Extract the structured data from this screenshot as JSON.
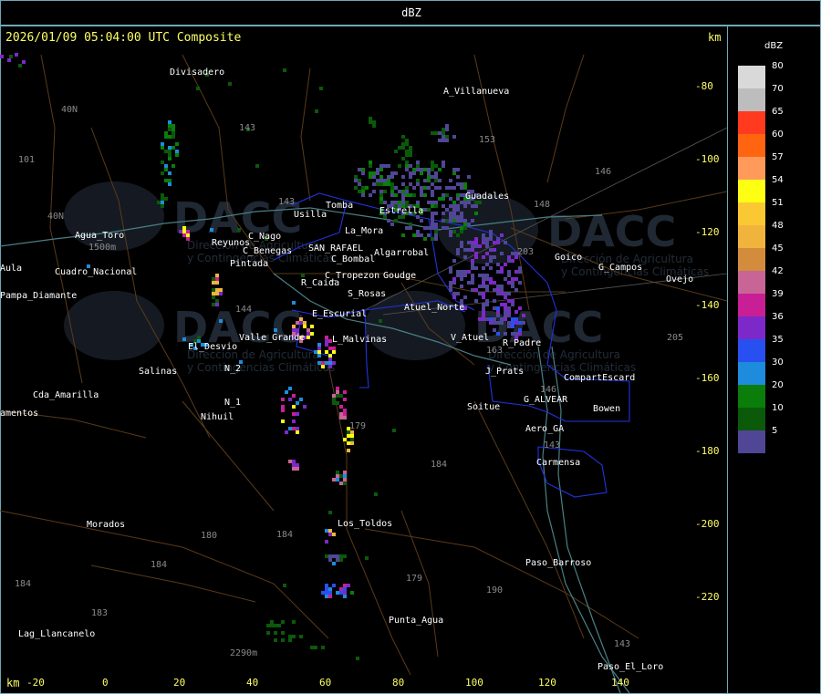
{
  "header": {
    "title": "dBZ"
  },
  "plot": {
    "timestamp": "2026/01/09 05:04:00 UTC Composite",
    "km_unit_top": "km",
    "km_unit_bottom": "km",
    "y_ticks": [
      "-80",
      "-100",
      "-120",
      "-140",
      "-160",
      "-180",
      "-200",
      "-220"
    ],
    "x_ticks": [
      "-20",
      "0",
      "20",
      "40",
      "60",
      "80",
      "100",
      "120",
      "140"
    ]
  },
  "legend": {
    "title": "dBZ",
    "levels": [
      {
        "label": "80",
        "color": "#d9d9d9"
      },
      {
        "label": "70",
        "color": "#bdbdbd"
      },
      {
        "label": "65",
        "color": "#ff3a1e"
      },
      {
        "label": "60",
        "color": "#ff6410"
      },
      {
        "label": "57",
        "color": "#ff9a5a"
      },
      {
        "label": "54",
        "color": "#ffff14"
      },
      {
        "label": "51",
        "color": "#fac832"
      },
      {
        "label": "48",
        "color": "#f0b43c"
      },
      {
        "label": "45",
        "color": "#d28c3c"
      },
      {
        "label": "42",
        "color": "#c86496"
      },
      {
        "label": "39",
        "color": "#c81e96"
      },
      {
        "label": "36",
        "color": "#7d28c8"
      },
      {
        "label": "35",
        "color": "#2850f0"
      },
      {
        "label": "30",
        "color": "#1e8cdc"
      },
      {
        "label": "20",
        "color": "#0a7d0a"
      },
      {
        "label": "10",
        "color": "#0a5a0a"
      },
      {
        "label": "5",
        "color": "#504696"
      }
    ]
  },
  "watermark": {
    "brand": "DACC",
    "line1": "Dirección de Agricultura",
    "line2": "y Contingencias Climáticas"
  },
  "places": [
    {
      "name": "Divisadero"
    },
    {
      "name": "A_Villanueva"
    },
    {
      "name": "Guadales"
    },
    {
      "name": "Usilla"
    },
    {
      "name": "Tomba"
    },
    {
      "name": "Estrella"
    },
    {
      "name": "Agua_Toro"
    },
    {
      "name": "Reyunos"
    },
    {
      "name": "C_Nago"
    },
    {
      "name": "C_Benegas"
    },
    {
      "name": "SAN_RAFAEL"
    },
    {
      "name": "La_Mora"
    },
    {
      "name": "Algarrobal"
    },
    {
      "name": "C_Bombal"
    },
    {
      "name": "Pintada"
    },
    {
      "name": "Aula"
    },
    {
      "name": "Pampa_Diamante"
    },
    {
      "name": "C_Tropezon"
    },
    {
      "name": "Goudge"
    },
    {
      "name": "R_Caida"
    },
    {
      "name": "S_Rosas"
    },
    {
      "name": "Atuel_Norte"
    },
    {
      "name": "E_Escurial"
    },
    {
      "name": "El_Desvio"
    },
    {
      "name": "Valle_Grande"
    },
    {
      "name": "L_Malvinas"
    },
    {
      "name": "V_Atuel"
    },
    {
      "name": "R_Padre"
    },
    {
      "name": "N_2"
    },
    {
      "name": "N_1"
    },
    {
      "name": "Salinas"
    },
    {
      "name": "J_Prats"
    },
    {
      "name": "CompartEscard"
    },
    {
      "name": "Cda_Amarilla"
    },
    {
      "name": "amentos"
    },
    {
      "name": "Nihuil"
    },
    {
      "name": "Soitue"
    },
    {
      "name": "G_ALVEAR"
    },
    {
      "name": "Bowen"
    },
    {
      "name": "Aero_GA"
    },
    {
      "name": "Carmensa"
    },
    {
      "name": "Morados"
    },
    {
      "name": "Los_Toldos"
    },
    {
      "name": "Paso_Barroso"
    },
    {
      "name": "Punta_Agua"
    },
    {
      "name": "Lag_Llancanelo"
    },
    {
      "name": "Paso_El_Loro"
    },
    {
      "name": "Goico"
    },
    {
      "name": "G_Campos"
    },
    {
      "name": "Ovejo"
    },
    {
      "name": "Cuadro_Nacional"
    }
  ],
  "route_numbers": [
    "143",
    "153",
    "146",
    "148",
    "101",
    "40N",
    "40N",
    "143",
    "144",
    "203",
    "163",
    "179",
    "184",
    "184",
    "180",
    "184",
    "183",
    "179",
    "190",
    "143",
    "143",
    "205",
    "184",
    "146"
  ],
  "elevations": [
    "1500m",
    "2290m"
  ],
  "overlay": {
    "province_border_color": "#2233dd",
    "road_color": "#5a3a1a",
    "river_color": "#4a7f86",
    "grid_color": "#555555"
  }
}
